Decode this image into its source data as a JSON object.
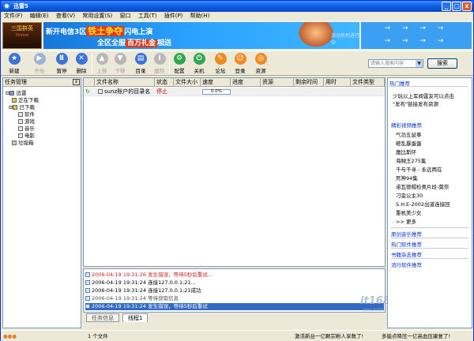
{
  "window": {
    "title": "迅雷5",
    "minimize": "_",
    "maximize": "□",
    "close": "x"
  },
  "menu": [
    "文件(F)",
    "编辑(E)",
    "查看(V)",
    "常用设置(S)",
    "窗口",
    "工具(T)",
    "插件(P)",
    "帮助(H)"
  ],
  "banner": {
    "logo_text": "三国群英",
    "logo_sub": "Online",
    "ad_line1": "新开电信3区",
    "ad_highlight1": "铁土争夺",
    "ad_line1b": "闪电上演",
    "ad_line2": "全区全服",
    "ad_highlight2": "百万礼金",
    "ad_line2b": "相送",
    "ad_tail": "活动热烈进行中",
    "arrows": "→ → → →"
  },
  "toolbar": {
    "buttons": [
      {
        "label": "新建",
        "icon": "new-icon",
        "enabled": true,
        "color": "#3b73d6"
      },
      {
        "label": "开始",
        "icon": "start-icon",
        "enabled": false,
        "color": "#9db0d6"
      },
      {
        "label": "暂停",
        "icon": "pause-icon",
        "enabled": true,
        "color": "#3b73d6"
      },
      {
        "label": "删除",
        "icon": "delete-icon",
        "enabled": true,
        "color": "#3b73d6"
      },
      {
        "label": "上移",
        "icon": "up-icon",
        "enabled": false,
        "color": "#b8b8b8"
      },
      {
        "label": "下移",
        "icon": "down-icon",
        "enabled": false,
        "color": "#b8b8b8"
      },
      {
        "label": "目录",
        "icon": "folder-icon",
        "enabled": true,
        "color": "#3b73d6"
      },
      {
        "label": "属性",
        "icon": "properties-icon",
        "enabled": false,
        "color": "#b8b8b8"
      },
      {
        "label": "配置",
        "icon": "config-icon",
        "enabled": true,
        "color": "#2ea84c"
      },
      {
        "label": "关机",
        "icon": "shutdown-icon",
        "enabled": true,
        "color": "#2ea84c"
      },
      {
        "label": "论坛",
        "icon": "forum-icon",
        "enabled": true,
        "color": "#f08a20"
      },
      {
        "label": "登录",
        "icon": "login-icon",
        "enabled": true,
        "color": "#f08a20"
      },
      {
        "label": "资源",
        "icon": "resource-icon",
        "enabled": true,
        "color": "#f08a20"
      }
    ],
    "search_placeholder": "请输入搜索内容",
    "search_button": "搜索"
  },
  "left_panel": {
    "title": "任务管理",
    "close": "x",
    "tree": [
      {
        "label": "迅雷",
        "level": 0
      },
      {
        "label": "正在下载",
        "level": 1
      },
      {
        "label": "已下载",
        "level": 1
      },
      {
        "label": "软件",
        "level": 2
      },
      {
        "label": "游戏",
        "level": 2
      },
      {
        "label": "音乐",
        "level": 2
      },
      {
        "label": "电影",
        "level": 2
      },
      {
        "label": "垃圾箱",
        "level": 1
      }
    ]
  },
  "task_table": {
    "columns": [
      "文件名称",
      "状态",
      "文件大小",
      "速度",
      "进度",
      "资源",
      "剩余时间",
      "用时",
      "文件类型"
    ],
    "rows": [
      {
        "name": "sunz账户的目录名",
        "status": "停止",
        "progress_text": "0.0%",
        "progress": 0.0
      }
    ]
  },
  "log": {
    "lines": [
      {
        "text": "2006-04-19 19:31:26 发生错误，等待5秒后重试...",
        "kind": "red"
      },
      {
        "text": "2006-04-19 19:31:24 连接127.0.0.1:21...",
        "kind": "normal"
      },
      {
        "text": "2006-04-19 19:31:24 连接127.0.0.1:21成功",
        "kind": "normal"
      },
      {
        "text": "2006-04-19 19:31:24 等待获取信息",
        "kind": "gray"
      },
      {
        "text": "2006-04-19 19:31:24 发生错误，等待5秒后重试",
        "kind": "sel"
      }
    ],
    "watermark": "it168.com",
    "watermark_sub": "www.it168.com"
  },
  "tabs": [
    "任务信息",
    "线程1"
  ],
  "right_panel": {
    "header": "热门推荐",
    "intro_line1": "少玩以上军阀雷友可以点击",
    "intro_line2": "\"发布\"链接发布资源",
    "section1": "精彩视频推荐",
    "items": [
      "气功五鼠拳",
      "砸乱暴蛋蛋",
      "魔比斯环",
      "海贼王275集",
      "千与千寻 - 永远两在",
      "死神94集",
      "诺瓦德帽检奥片段-莫奈",
      "刁蛮公主30",
      "S.H.E-2002出道连接回",
      "重帆美少女",
      ">> 更多"
    ],
    "section2": "原创音乐推荐",
    "section3": "热门软件推荐",
    "section4": "书籍杂志推荐",
    "section5": "流行软件推荐"
  },
  "status_bar": {
    "count": "1 个文件",
    "msg1": "激活新台一亿颗宗粉人享数了!",
    "msg2": "多能点降压一亿高血压康复了!"
  }
}
